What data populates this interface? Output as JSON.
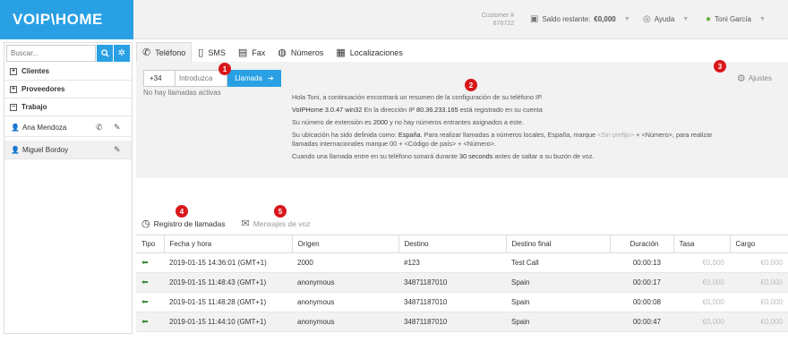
{
  "header": {
    "logo": "VOIP\\HOME",
    "customer_label": "Customer #",
    "customer_number": "678722",
    "balance_label": "Saldo restante:",
    "balance_value": "€0,000",
    "help": "Ayuda",
    "user": "Toni García"
  },
  "sidebar": {
    "search_placeholder": "Buscar...",
    "sections": [
      "Clientes",
      "Proveedores",
      "Trabajo"
    ],
    "contacts": [
      "Ana Mendoza",
      "Miguel Bordoy"
    ]
  },
  "tabs": [
    "Teléfono",
    "SMS",
    "Fax",
    "Números",
    "Localizaciones"
  ],
  "dialer": {
    "prefix": "+34",
    "placeholder": "Introduzca",
    "call_button": "Llamada",
    "no_calls": "No hay llamadas activas"
  },
  "settings_label": "Ajustes",
  "info": {
    "line1": "Hola Toni, a continuación encontrará un resumen de la configuración de su teléfono IP.",
    "line2_a": "VoIPHome 3.0.47 win32",
    "line2_b": " En la dirección IP ",
    "line2_ip": "80.36.233.165",
    "line2_c": " está registrado en su cuenta",
    "line3_a": "Su número de extensión es ",
    "line3_ext": "2000",
    "line3_b": " y no hay números entrantes asignados a este.",
    "line4_a": "Su ubicación ha sido definida como: ",
    "line4_loc": "España",
    "line4_b": ". Para realizar llamadas a números locales, España, marque ",
    "line4_noprefix": "<Sin prefijo>",
    "line4_c": " + <Número>, para realizar",
    "line5": "llamadas internacionales marque 00 + <Código de país> + <Número>.",
    "line6_a": "Cuando una llamada entre en su teléfono sonará durante ",
    "line6_secs": "30 seconds",
    "line6_b": " antes de saltar a su buzón de voz."
  },
  "badges": [
    "1",
    "2",
    "3",
    "4",
    "5"
  ],
  "log_tabs": [
    "Registro de llamadas",
    "Mensajes de voz"
  ],
  "table": {
    "headers": [
      "Tipo",
      "Fecha y hora",
      "Origen",
      "Destino",
      "Destino final",
      "Duración",
      "Tasa",
      "Cargo"
    ],
    "rows": [
      [
        "2019-01-15 14:36:01 (GMT+1)",
        "2000",
        "#123",
        "Test Call",
        "00:00:13",
        "€0,000",
        "€0,000"
      ],
      [
        "2019-01-15 11:48:43 (GMT+1)",
        "anonymous",
        "34871187010",
        "Spain",
        "00:00:17",
        "€0,000",
        "€0,000"
      ],
      [
        "2019-01-15 11:48:28 (GMT+1)",
        "anonymous",
        "34871187010",
        "Spain",
        "00:00:08",
        "€0,000",
        "€0,000"
      ],
      [
        "2019-01-15 11:44:10 (GMT+1)",
        "anonymous",
        "34871187010",
        "Spain",
        "00:00:47",
        "€0,000",
        "€0,000"
      ]
    ]
  },
  "colors": {
    "accent": "#2aa0e4",
    "badge": "#d9171b",
    "incoming_arrow": "#3c8d3c"
  }
}
